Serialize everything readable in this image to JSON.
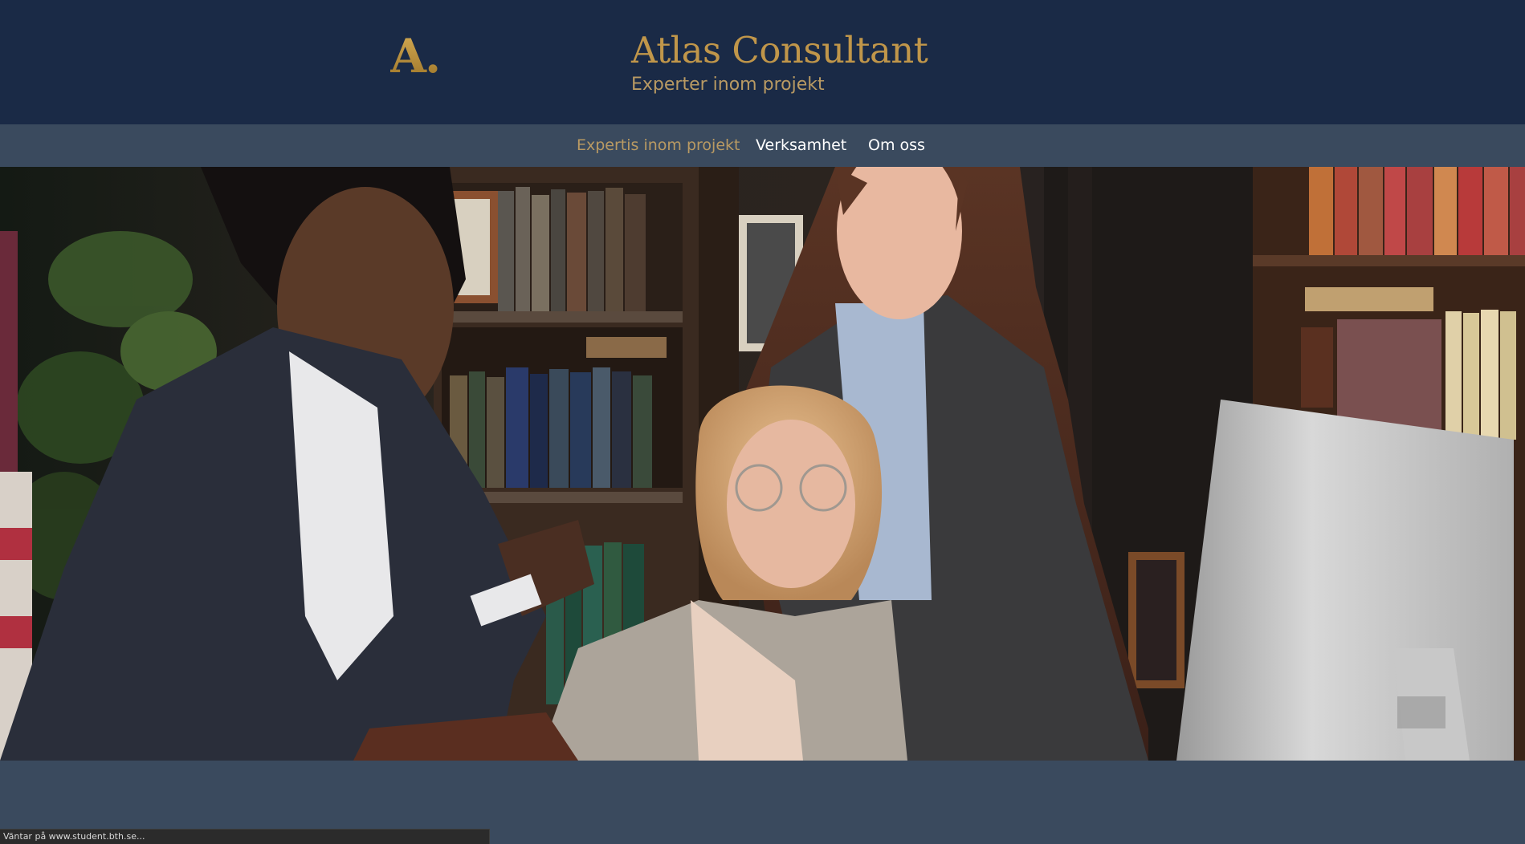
{
  "header": {
    "logo_text": "A.",
    "title": "Atlas Consultant",
    "tagline": "Experter inom projekt"
  },
  "nav": {
    "items": [
      {
        "label": "Expertis inom projekt",
        "active": true
      },
      {
        "label": "Verksamhet",
        "active": false
      },
      {
        "label": "Om oss",
        "active": false
      }
    ]
  },
  "hero": {
    "image": "hero-photo"
  },
  "status_bar": {
    "text": "Väntar på www.student.bth.se..."
  },
  "colors": {
    "header_bg": "#1a2a46",
    "nav_bg": "#3a4a5e",
    "accent_gold": "#c0964a",
    "nav_text": "#ffffff",
    "nav_active_text": "#b99a63"
  }
}
